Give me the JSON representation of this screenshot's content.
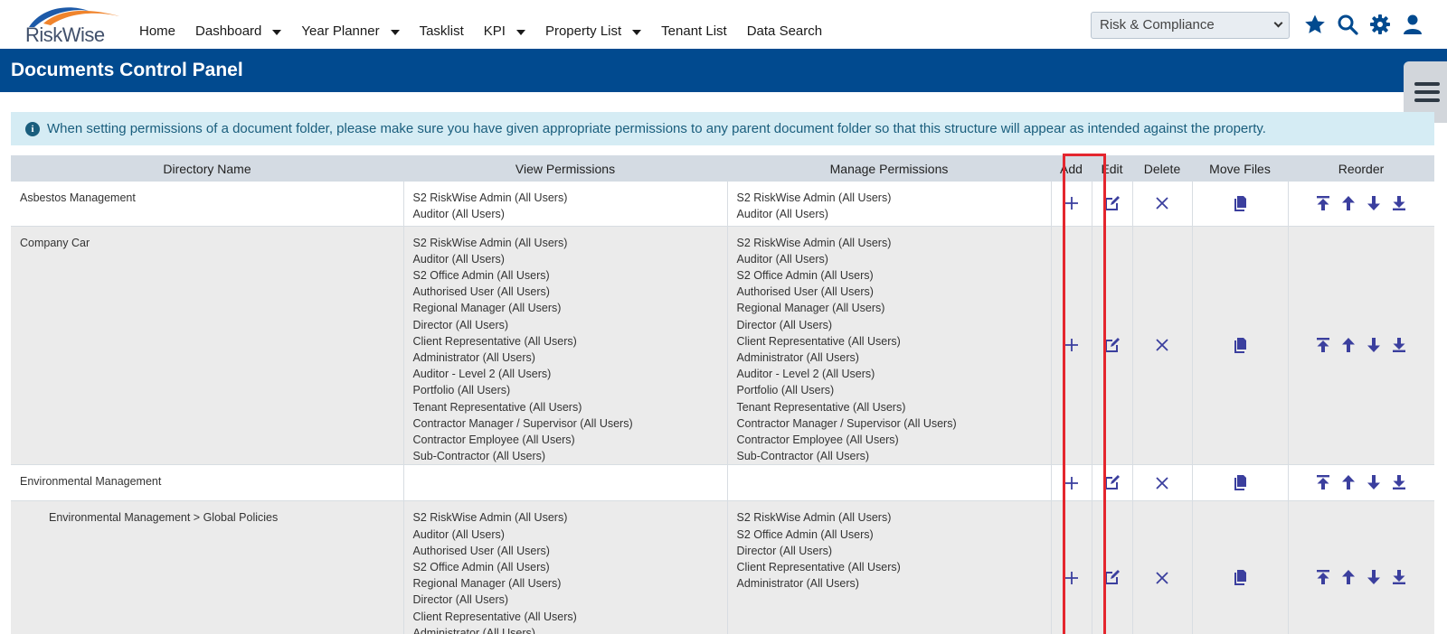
{
  "brand": {
    "logo_text": "RiskWise",
    "accent": "#014a8f",
    "swoosh_blue": "#1d5aa8",
    "swoosh_orange": "#f0842c"
  },
  "nav": [
    {
      "label": "Home",
      "dropdown": false
    },
    {
      "label": "Dashboard",
      "dropdown": true
    },
    {
      "label": "Year Planner",
      "dropdown": true
    },
    {
      "label": "Tasklist",
      "dropdown": false
    },
    {
      "label": "KPI",
      "dropdown": true
    },
    {
      "label": "Property List",
      "dropdown": true
    },
    {
      "label": "Tenant List",
      "dropdown": false
    },
    {
      "label": "Data Search",
      "dropdown": false
    }
  ],
  "module_select": {
    "value": "Risk & Compliance"
  },
  "top_icons": [
    "star-icon",
    "search-icon",
    "gear-icon",
    "user-icon"
  ],
  "page_title": "Documents Control Panel",
  "alert": {
    "text": "When setting permissions of a document folder, please make sure you have given appropriate permissions to any parent document folder so that this structure will appear as intended against the property."
  },
  "table": {
    "headers": [
      "Directory Name",
      "View Permissions",
      "Manage Permissions",
      "Add",
      "Edit",
      "Delete",
      "Move Files",
      "Reorder"
    ],
    "rows": [
      {
        "name": "Asbestos Management",
        "sub": false,
        "view": [
          "S2 RiskWise Admin (All Users)",
          "Auditor (All Users)"
        ],
        "manage": [
          "S2 RiskWise Admin (All Users)",
          "Auditor (All Users)"
        ]
      },
      {
        "name": "Company Car",
        "sub": false,
        "view": [
          "S2 RiskWise Admin (All Users)",
          "Auditor (All Users)",
          "S2 Office Admin (All Users)",
          "Authorised User (All Users)",
          "Regional Manager (All Users)",
          "Director (All Users)",
          "Client Representative (All Users)",
          "Administrator (All Users)",
          "Auditor - Level 2 (All Users)",
          "Portfolio (All Users)",
          "Tenant Representative (All Users)",
          "Contractor Manager / Supervisor (All Users)",
          "Contractor Employee (All Users)",
          "Sub-Contractor (All Users)"
        ],
        "manage": [
          "S2 RiskWise Admin (All Users)",
          "Auditor (All Users)",
          "S2 Office Admin (All Users)",
          "Authorised User (All Users)",
          "Regional Manager (All Users)",
          "Director (All Users)",
          "Client Representative (All Users)",
          "Administrator (All Users)",
          "Auditor - Level 2 (All Users)",
          "Portfolio (All Users)",
          "Tenant Representative (All Users)",
          "Contractor Manager / Supervisor (All Users)",
          "Contractor Employee (All Users)",
          "Sub-Contractor (All Users)"
        ]
      },
      {
        "name": "Environmental Management",
        "sub": false,
        "view": [],
        "manage": []
      },
      {
        "name": "Environmental Management > Global Policies",
        "sub": true,
        "view": [
          "S2 RiskWise Admin (All Users)",
          "Auditor (All Users)",
          "Authorised User (All Users)",
          "S2 Office Admin (All Users)",
          "Regional Manager (All Users)",
          "Director (All Users)",
          "Client Representative (All Users)",
          "Administrator (All Users)"
        ],
        "manage": [
          "S2 RiskWise Admin (All Users)",
          "S2 Office Admin (All Users)",
          "Director (All Users)",
          "Client Representative (All Users)",
          "Administrator (All Users)"
        ]
      }
    ]
  },
  "colors": {
    "action_icon": "#3b3f9e",
    "header_bg": "#d4dbe3",
    "alert_bg": "#d5ecf4",
    "highlight": "#e4262e"
  }
}
